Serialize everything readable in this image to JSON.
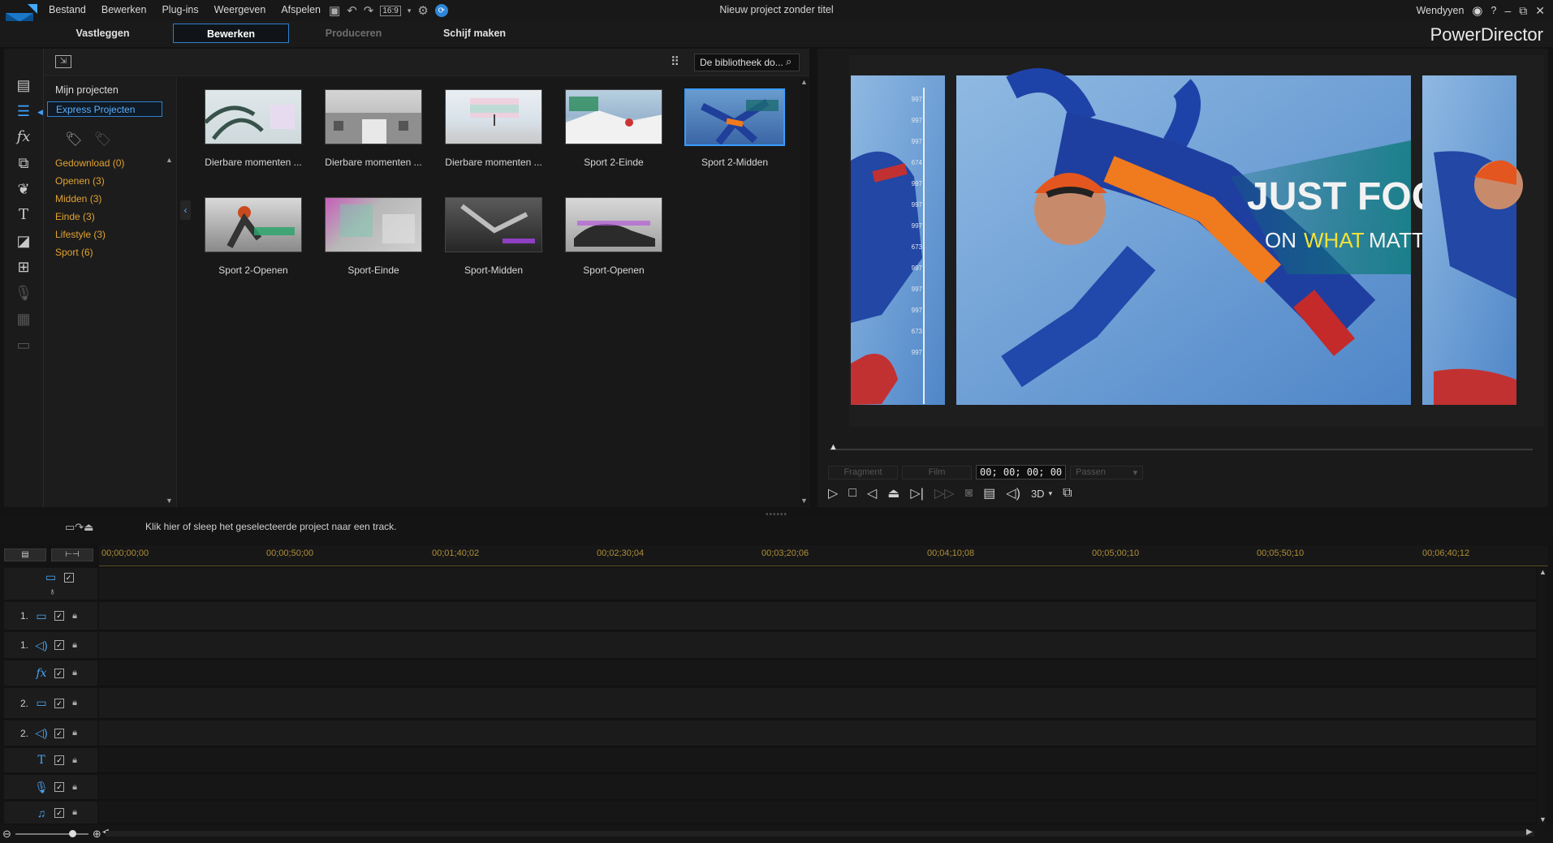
{
  "app": {
    "project_title": "Nieuw project zonder titel",
    "brand": "PowerDirector",
    "user": "Wendyyen",
    "help": "?",
    "window_controls": [
      "–",
      "⧉",
      "✕"
    ]
  },
  "menu": [
    "Bestand",
    "Bewerken",
    "Plug-ins",
    "Weergeven",
    "Afspelen"
  ],
  "quick_toolbar": {
    "aspect": "16:9"
  },
  "tabs": [
    {
      "label": "Vastleggen",
      "state": "normal"
    },
    {
      "label": "Bewerken",
      "state": "active"
    },
    {
      "label": "Produceren",
      "state": "disabled"
    },
    {
      "label": "Schijf maken",
      "state": "normal"
    }
  ],
  "library": {
    "search_placeholder": "De bibliotheek do...",
    "my_projects": "Mijn projecten",
    "express_projects": "Express Projecten",
    "categories": [
      "Gedownload  (0)",
      "Openen  (3)",
      "Midden  (3)",
      "Einde  (3)",
      "Lifestyle  (3)",
      "Sport  (6)"
    ],
    "templates": [
      {
        "label": "Dierbare momenten ...",
        "art": "palm"
      },
      {
        "label": "Dierbare momenten ...",
        "art": "building"
      },
      {
        "label": "Dierbare momenten ...",
        "art": "beach"
      },
      {
        "label": "Sport 2-Einde",
        "art": "ski"
      },
      {
        "label": "Sport 2-Midden",
        "art": "skydive"
      },
      {
        "label": "Sport 2-Openen",
        "art": "challenge"
      },
      {
        "label": "Sport-Einde",
        "art": "blur"
      },
      {
        "label": "Sport-Midden",
        "art": "dancer"
      },
      {
        "label": "Sport-Openen",
        "art": "shoes"
      }
    ]
  },
  "preview": {
    "overlay_line1": "JUST FOCUS",
    "overlay_on": "ON",
    "overlay_what": "WHAT",
    "overlay_matters": "MATTERS",
    "ruler_marks": [
      "997",
      "997",
      "997",
      "674",
      "997",
      "997",
      "997",
      "673",
      "997",
      "997",
      "997",
      "673",
      "997"
    ],
    "mode_fragment": "Fragment",
    "mode_film": "Film",
    "timecode": "00; 00; 00; 00",
    "fit": "Passen",
    "threeD": "3D"
  },
  "timeline": {
    "hint": "Klik hier of sleep het geselecteerde project naar een track.",
    "ruler": [
      "00;00;00;00",
      "00;00;50;00",
      "00;01;40;02",
      "00;02;30;04",
      "00;03;20;06",
      "00;04;10;08",
      "00;05;00;10",
      "00;05;50;10",
      "00;06;40;12"
    ],
    "tracks": [
      {
        "num": "1.",
        "type": "video"
      },
      {
        "num": "1.",
        "type": "audio"
      },
      {
        "num": "",
        "type": "fx"
      },
      {
        "num": "2.",
        "type": "video"
      },
      {
        "num": "2.",
        "type": "audio"
      },
      {
        "num": "",
        "type": "title"
      },
      {
        "num": "",
        "type": "voice"
      },
      {
        "num": "",
        "type": "music"
      }
    ]
  },
  "colors": {
    "accent": "#2f7fd0",
    "category": "#e2a332",
    "ruler": "#b08f3a",
    "track_icon": "#4aa3f0"
  }
}
